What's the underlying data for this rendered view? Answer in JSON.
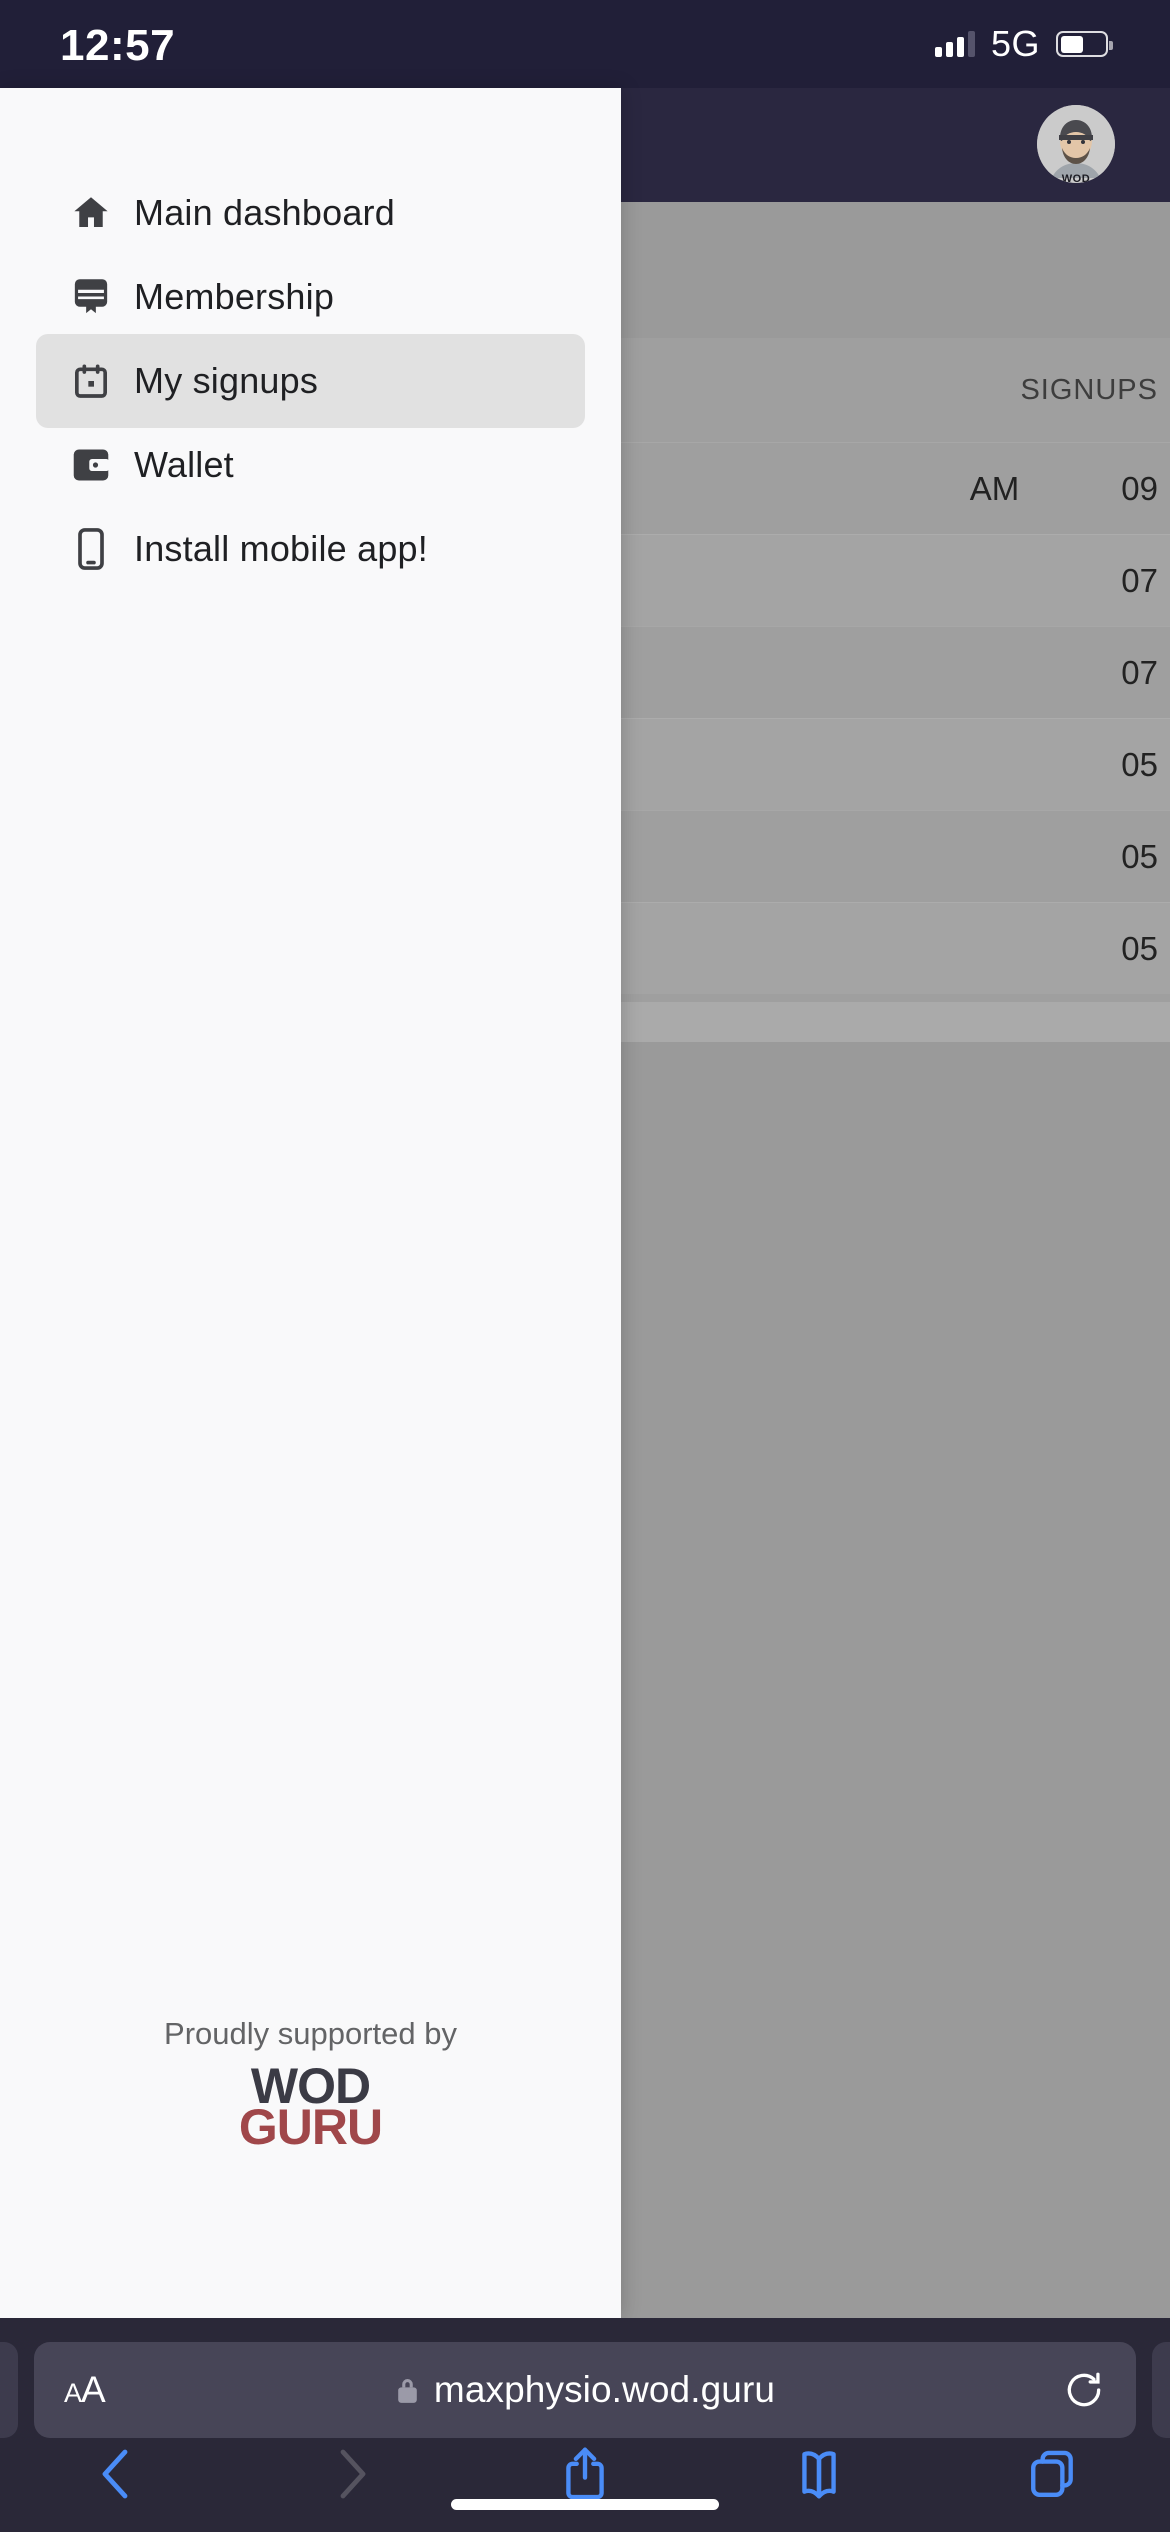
{
  "status_bar": {
    "time": "12:57",
    "network": "5G",
    "signal_icon": "signal-bars-icon",
    "battery_icon": "battery-icon",
    "background_color": "#211f38"
  },
  "drawer": {
    "background_color": "#f9f9fa",
    "active_highlight_color": "#e1e1e1",
    "items": [
      {
        "label": "Main dashboard",
        "icon": "home-icon",
        "active": false
      },
      {
        "label": "Membership",
        "icon": "membership-card-icon",
        "active": false
      },
      {
        "label": "My signups",
        "icon": "calendar-icon",
        "active": true
      },
      {
        "label": "Wallet",
        "icon": "wallet-icon",
        "active": false
      },
      {
        "label": "Install mobile app!",
        "icon": "mobile-phone-icon",
        "active": false
      }
    ],
    "footer": {
      "supported_text": "Proudly supported by",
      "brand_line1": "WOD",
      "brand_line2": "GURU",
      "brand_color_1": "#3b3b45",
      "brand_color_2": "#a0474a"
    }
  },
  "page_behind": {
    "header_background": "#2a2740",
    "avatar_label": "WOD",
    "avatar_icon": "user-avatar",
    "table": {
      "header": "SIGNUPS",
      "rows": [
        {
          "col_am": "AM",
          "col_time": "09"
        },
        {
          "col_am": "",
          "col_time": "07"
        },
        {
          "col_am": "",
          "col_time": "07"
        },
        {
          "col_am": "",
          "col_time": "05"
        },
        {
          "col_am": "",
          "col_time": "05"
        },
        {
          "col_am": "",
          "col_time": "05"
        }
      ]
    }
  },
  "browser": {
    "background_color": "#2a2838",
    "text_size_button": "AA",
    "lock_icon": "lock-icon",
    "url": "maxphysio.wod.guru",
    "reload_icon": "reload-icon",
    "toolbar": [
      {
        "name": "back-button",
        "icon": "chevron-left-icon",
        "enabled": true
      },
      {
        "name": "forward-button",
        "icon": "chevron-right-icon",
        "enabled": false
      },
      {
        "name": "share-button",
        "icon": "share-icon",
        "enabled": true
      },
      {
        "name": "bookmarks-button",
        "icon": "book-icon",
        "enabled": true
      },
      {
        "name": "tabs-button",
        "icon": "tabs-icon",
        "enabled": true
      }
    ],
    "accent_color": "#4a8cf7"
  }
}
